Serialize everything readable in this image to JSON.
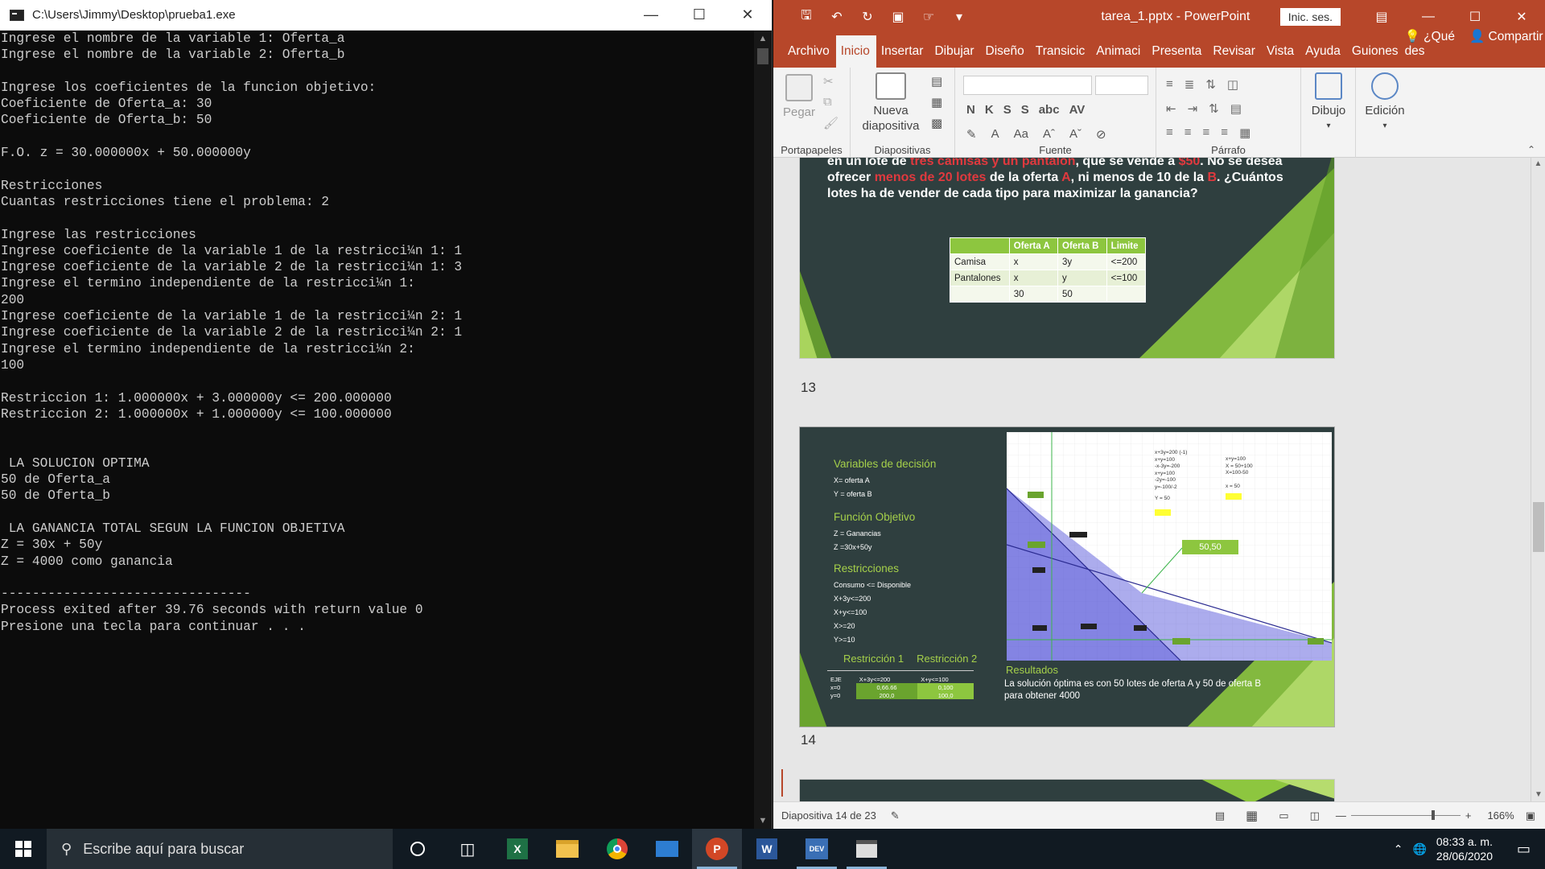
{
  "console": {
    "title": "C:\\Users\\Jimmy\\Desktop\\prueba1.exe",
    "lines": [
      "Ingrese el nombre de la variable 1: Oferta_a",
      "Ingrese el nombre de la variable 2: Oferta_b",
      "",
      "Ingrese los coeficientes de la funcion objetivo:",
      "Coeficiente de Oferta_a: 30",
      "Coeficiente de Oferta_b: 50",
      "",
      "F.O. z = 30.000000x + 50.000000y",
      "",
      "Restricciones",
      "Cuantas restricciones tiene el problema: 2",
      "",
      "Ingrese las restricciones",
      "Ingrese coeficiente de la variable 1 de la restricci¼n 1: 1",
      "Ingrese coeficiente de la variable 2 de la restricci¼n 1: 3",
      "Ingrese el termino independiente de la restricci¼n 1:",
      "200",
      "Ingrese coeficiente de la variable 1 de la restricci¼n 2: 1",
      "Ingrese coeficiente de la variable 2 de la restricci¼n 2: 1",
      "Ingrese el termino independiente de la restricci¼n 2:",
      "100",
      "",
      "Restriccion 1: 1.000000x + 3.000000y <= 200.000000",
      "Restriccion 2: 1.000000x + 1.000000y <= 100.000000",
      "",
      "",
      " LA SOLUCION OPTIMA",
      "50 de Oferta_a",
      "50 de Oferta_b",
      "",
      " LA GANANCIA TOTAL SEGUN LA FUNCION OBJETIVA",
      "Z = 30x + 50y",
      "Z = 4000 como ganancia",
      "",
      "--------------------------------",
      "Process exited after 39.76 seconds with return value 0",
      "Presione una tecla para continuar . . ."
    ]
  },
  "ppt": {
    "title": "tarea_1.pptx  -  PowerPoint",
    "signin": "Inic. ses.",
    "tabs": [
      "Archivo",
      "Inicio",
      "Insertar",
      "Dibujar",
      "Diseño",
      "Transicic",
      "Animaci",
      "Presenta",
      "Revisar",
      "Vista",
      "Ayuda",
      "Guiones"
    ],
    "active_tab": "Inicio",
    "tell_me": "¿Qué des",
    "share": "Compartir",
    "ribbon": {
      "paste": "Pegar",
      "new_slide_1": "Nueva",
      "new_slide_2": "diapositiva",
      "draw": "Dibujo",
      "edit": "Edición",
      "groups": [
        "Portapapeles",
        "Diapositivas",
        "Fuente",
        "Párrafo"
      ],
      "font_icons": [
        "N",
        "K",
        "S",
        "S",
        "abc",
        "AV"
      ]
    },
    "slide13": {
      "text_a": "en un lote de ",
      "text_b": "tres camisas y un pantalón",
      "text_c": ", que se vende a ",
      "text_d": "$50",
      "text_e": ". No se desea ofrecer ",
      "text_f": "menos de 20 lotes",
      "text_g": " de la oferta ",
      "text_h": "A",
      "text_i": ", ni menos de 10 de la ",
      "text_j": "B",
      "text_k": ". ¿Cuántos lotes ha de vender de cada tipo para maximizar la ganancia?",
      "table_headers": [
        "",
        "Oferta A",
        "Oferta B",
        "Limite"
      ],
      "table_rows": [
        [
          "Camisa",
          "x",
          "3y",
          "<=200"
        ],
        [
          "Pantalones",
          "x",
          "y",
          "<=100"
        ],
        [
          "",
          "30",
          "50",
          ""
        ]
      ],
      "number": "13"
    },
    "slide14": {
      "number": "14",
      "h_vars": "Variables de decisión",
      "var_x": "X= oferta A",
      "var_y": "Y = oferta B",
      "h_fo": "Función Objetivo",
      "fo_1": "Z = Ganancias",
      "fo_2": "Z =30x+50y",
      "h_restr": "Restricciones",
      "r0": "Consumo <= Disponible",
      "r1": "X+3y<=200",
      "r2": "X+y<=100",
      "r3": "X>=20",
      "r4": "Y>=10",
      "restr_1": "Restricción 1",
      "restr_2": "Restricción 2",
      "eje_table": [
        [
          "EJE",
          "X+3y<=200",
          "X+y<=100"
        ],
        [
          "x=0",
          "0,66.66",
          "0,100"
        ],
        [
          "y=0",
          "200,0",
          "100,0"
        ]
      ],
      "chart_label": "50,50",
      "chart_note_1": "x+3y=200 (-1)",
      "chart_note_2": "x+y=100",
      "chart_note_3": "-x-3y=-200",
      "chart_note_4": "x+y=100",
      "chart_note_5": "-2y=-100",
      "chart_note_6": "y=-100/-2",
      "chart_note_7": "Y = 50",
      "chart_note_8": "x+y=100",
      "chart_note_9": "X = 50+100",
      "chart_note_10": "X=100-50",
      "chart_note_11": "x = 50",
      "results_h": "Resultados",
      "results_t": "La solución óptima es con 50 lotes de oferta A y 50 de oferta B para obtener 4000"
    },
    "status": {
      "slide": "Diapositiva 14 de 23",
      "zoom": "166%"
    }
  },
  "taskbar": {
    "search": "Escribe aquí para buscar",
    "time": "08:33 a. m.",
    "date": "28/06/2020"
  },
  "colors": {
    "ppt_accent": "#b7472a",
    "slide_bg": "#2f3f3f",
    "slide_green": "#8dc63f",
    "red_text": "#e0393e"
  }
}
